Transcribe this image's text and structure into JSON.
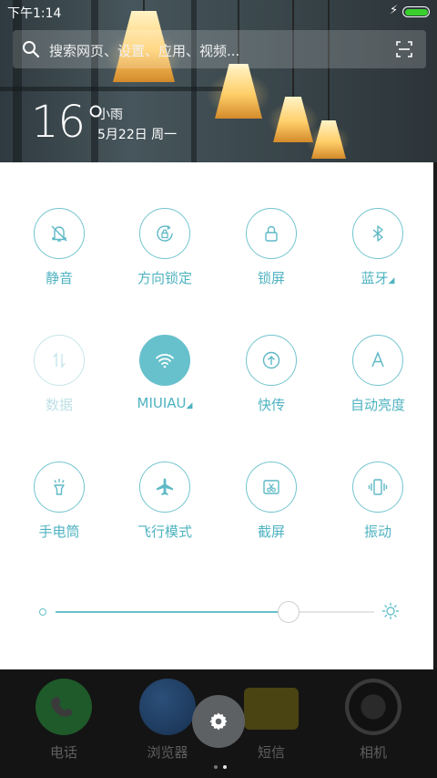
{
  "status_bar": {
    "time": "下午1:14",
    "battery_color": "#39d02f"
  },
  "search": {
    "placeholder": "搜索网页、设置、应用、视频..."
  },
  "weather": {
    "temperature": "16°",
    "condition": "小雨",
    "date": "5月22日 周一"
  },
  "accent_color": "#67c1cc",
  "toggles": [
    {
      "label": "静音",
      "icon": "bell-off-icon",
      "state": "off"
    },
    {
      "label": "方向锁定",
      "icon": "rotation-lock-icon",
      "state": "off"
    },
    {
      "label": "锁屏",
      "icon": "lock-icon",
      "state": "off"
    },
    {
      "label": "蓝牙",
      "icon": "bluetooth-icon",
      "state": "off",
      "has_submenu": true
    },
    {
      "label": "数据",
      "icon": "mobile-data-icon",
      "state": "disabled"
    },
    {
      "label": "MIUIAU",
      "icon": "wifi-icon",
      "state": "on",
      "has_submenu": true
    },
    {
      "label": "快传",
      "icon": "quick-transfer-icon",
      "state": "off"
    },
    {
      "label": "自动亮度",
      "icon": "auto-brightness-icon",
      "state": "off"
    },
    {
      "label": "手电筒",
      "icon": "flashlight-icon",
      "state": "off"
    },
    {
      "label": "飞行模式",
      "icon": "airplane-icon",
      "state": "off"
    },
    {
      "label": "截屏",
      "icon": "screenshot-icon",
      "state": "off"
    },
    {
      "label": "振动",
      "icon": "vibrate-icon",
      "state": "off"
    }
  ],
  "brightness": {
    "level": 0.73
  },
  "dock": [
    {
      "label": "电话",
      "icon": "phone-icon"
    },
    {
      "label": "浏览器",
      "icon": "browser-icon"
    },
    {
      "label": "短信",
      "icon": "messages-icon"
    },
    {
      "label": "相机",
      "icon": "camera-icon"
    }
  ],
  "page_indicator": {
    "pages": 2,
    "current": 2
  }
}
